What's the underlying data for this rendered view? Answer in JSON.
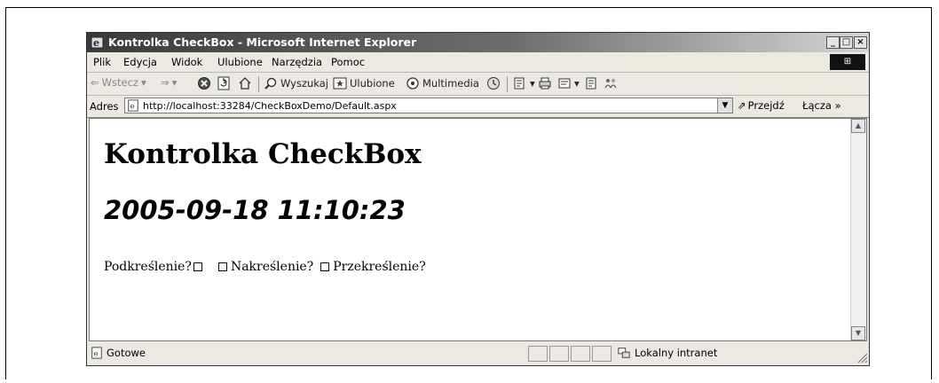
{
  "window": {
    "title": "Kontrolka CheckBox - Microsoft Internet Explorer",
    "minimize": "_",
    "maximize": "□",
    "close": "×"
  },
  "menu": [
    "Plik",
    "Edycja",
    "Widok",
    "Ulubione",
    "Narzędzia",
    "Pomoc"
  ],
  "toolbar": {
    "back": "Wstecz",
    "search": "Wyszukaj",
    "favorites": "Ulubione",
    "media": "Multimedia"
  },
  "address": {
    "label": "Adres",
    "url": "http://localhost:33284/CheckBoxDemo/Default.aspx",
    "go": "Przejdź",
    "links": "Łącza »"
  },
  "page": {
    "heading": "Kontrolka CheckBox",
    "datetime": "2005-09-18 11:10:23",
    "checkboxes": [
      {
        "label": "Podkreślenie?",
        "checked": false
      },
      {
        "label": "Nakreślenie?",
        "checked": false
      },
      {
        "label": "Przekreślenie?",
        "checked": false
      }
    ]
  },
  "status": {
    "text": "Gotowe",
    "zone": "Lokalny intranet"
  }
}
